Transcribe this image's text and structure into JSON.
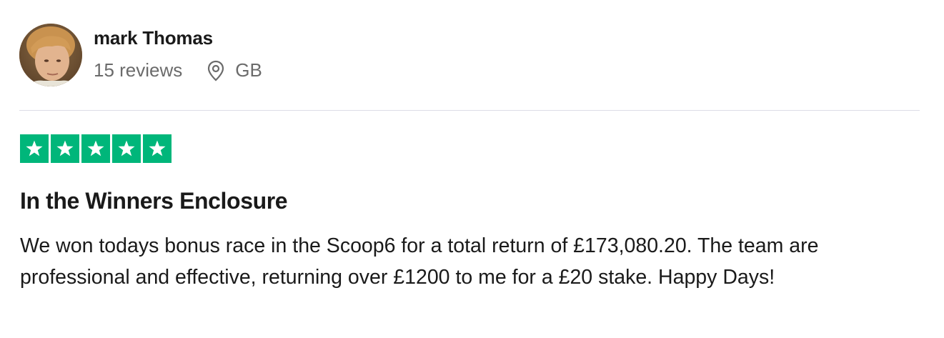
{
  "consumer": {
    "name": "mark Thomas",
    "review_count": "15 reviews",
    "country": "GB",
    "avatar": "profile-photo",
    "location_icon": "location-pin-icon"
  },
  "rating": {
    "stars": 5,
    "max_stars": 5,
    "star_icon": "star-icon",
    "color": "#00b67a"
  },
  "review": {
    "title": "In the Winners Enclosure",
    "body": "We won todays bonus race in the Scoop6 for a total return of £173,080.20. The team are professional and effective, returning over £1200 to me for a £20 stake. Happy Days!"
  },
  "colors": {
    "text_primary": "#1a1a1a",
    "text_secondary": "#6b6b6b",
    "divider": "#dcdce6",
    "star_green": "#00b67a"
  }
}
